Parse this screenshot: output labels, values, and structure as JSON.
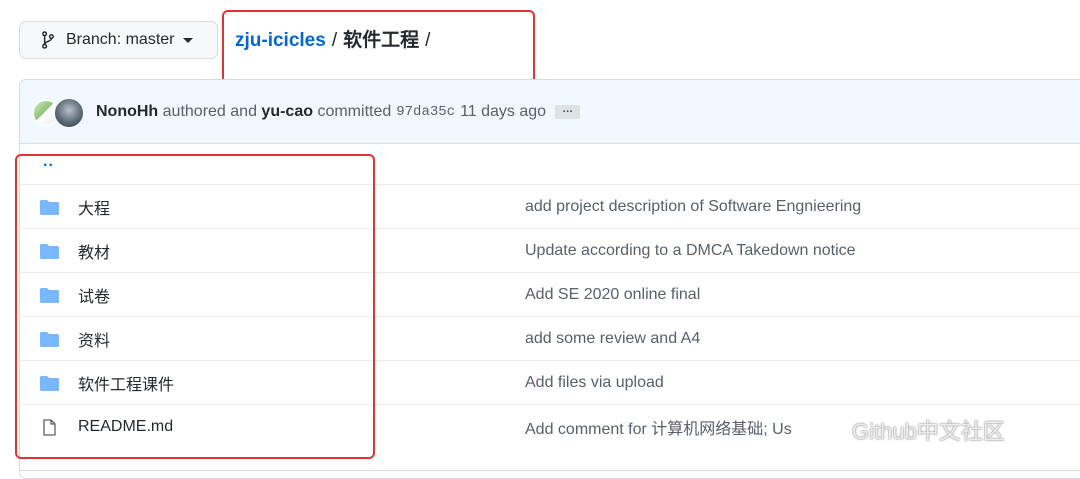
{
  "branch": {
    "label": "Branch: master"
  },
  "breadcrumb": {
    "repo": "zju-icicles",
    "separator": "/",
    "current": "软件工程",
    "trailing": "/"
  },
  "commit": {
    "author": "NonoHh",
    "authored_text": "authored and",
    "committer": "yu-cao",
    "committed_text": "committed",
    "sha": "97da35c",
    "age": "11 days ago",
    "ellipsis": "…"
  },
  "files": {
    "up": "..",
    "rows": [
      {
        "name": "大程",
        "type": "folder",
        "message": "add project description of Software Engnieering"
      },
      {
        "name": "教材",
        "type": "folder",
        "message": "Update according to a DMCA Takedown notice"
      },
      {
        "name": "试卷",
        "type": "folder",
        "message": "Add SE 2020 online final"
      },
      {
        "name": "资料",
        "type": "folder",
        "message": "add some review and A4"
      },
      {
        "name": "软件工程课件",
        "type": "folder",
        "message": "Add files via upload"
      },
      {
        "name": "README.md",
        "type": "file",
        "message": "Add comment for 计算机网络基础; Us"
      }
    ]
  },
  "watermark": {
    "text": "Github中文社区"
  },
  "colors": {
    "link": "#0366d6",
    "folder": "#79b8ff",
    "annotation": "#e03434",
    "header_bg": "#f1f8ff"
  },
  "icons": {
    "branch": "git-branch-icon",
    "folder": "folder-icon",
    "file": "file-icon",
    "caret": "caret-down-icon"
  }
}
